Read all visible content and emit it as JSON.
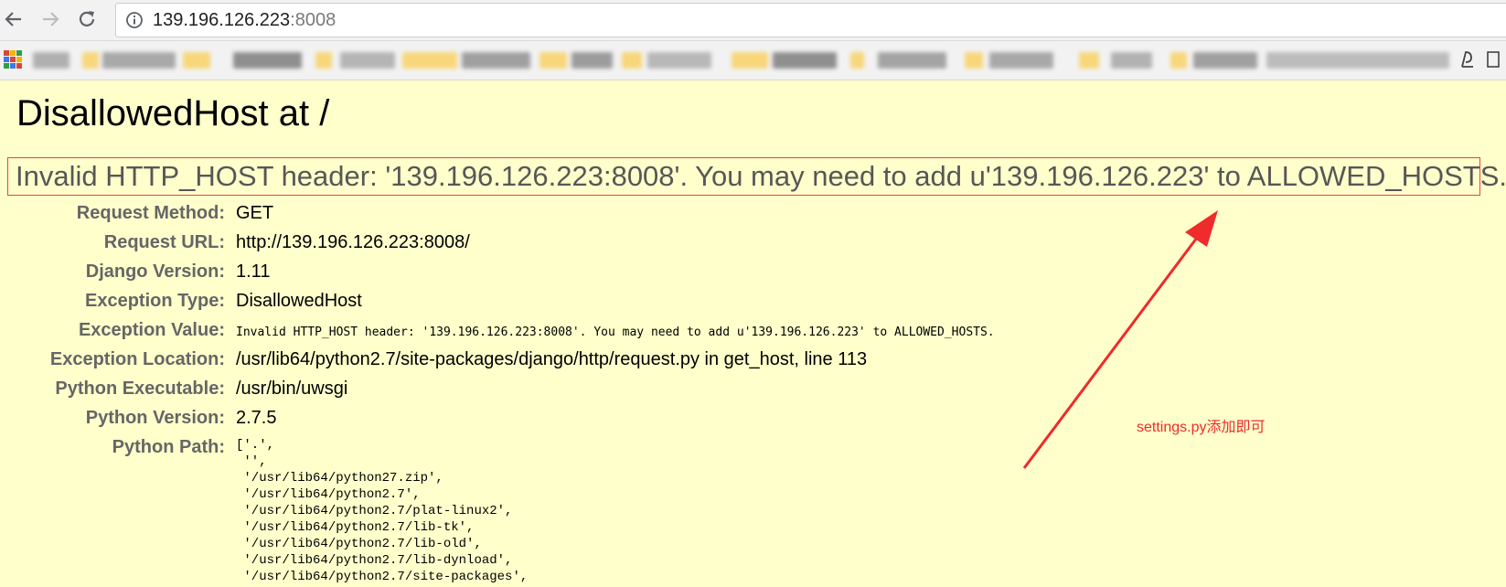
{
  "browser": {
    "url_host": "139.196.126.223",
    "url_port": ":8008"
  },
  "page": {
    "title": "DisallowedHost at /",
    "exception_value": "Invalid HTTP_HOST header: '139.196.126.223:8008'. You may need to add u'139.196.126.223' to ALLOWED_HOSTS.",
    "meta": [
      {
        "label": "Request Method:",
        "value": "GET"
      },
      {
        "label": "Request URL:",
        "value": "http://139.196.126.223:8008/"
      },
      {
        "label": "Django Version:",
        "value": "1.11"
      },
      {
        "label": "Exception Type:",
        "value": "DisallowedHost"
      },
      {
        "label": "Exception Value:",
        "value": "Invalid HTTP_HOST header: '139.196.126.223:8008'. You may need to add u'139.196.126.223' to ALLOWED_HOSTS."
      },
      {
        "label": "Exception Location:",
        "value": "/usr/lib64/python2.7/site-packages/django/http/request.py in get_host, line 113"
      },
      {
        "label": "Python Executable:",
        "value": "/usr/bin/uwsgi"
      },
      {
        "label": "Python Version:",
        "value": "2.7.5"
      },
      {
        "label": "Python Path:",
        "value": ""
      }
    ],
    "python_path": [
      "['.',",
      " '',",
      " '/usr/lib64/python27.zip',",
      " '/usr/lib64/python2.7',",
      " '/usr/lib64/python2.7/plat-linux2',",
      " '/usr/lib64/python2.7/lib-tk',",
      " '/usr/lib64/python2.7/lib-old',",
      " '/usr/lib64/python2.7/lib-dynload',",
      " '/usr/lib64/python2.7/site-packages',"
    ]
  },
  "annotation": {
    "text": "settings.py添加即可",
    "color": "#ef2b2b"
  },
  "icons": [
    "back-arrow-icon",
    "forward-arrow-icon",
    "reload-icon",
    "info-icon",
    "apps-icon"
  ]
}
